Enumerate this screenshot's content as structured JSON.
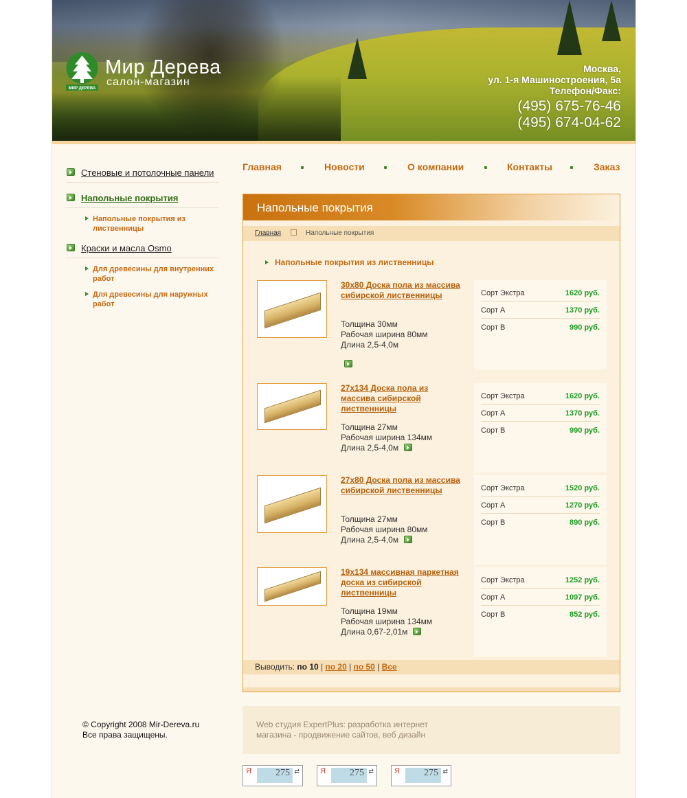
{
  "brand": {
    "title": "Мир Дерева",
    "subtitle": "салон-магазин",
    "mark_text": "МИР ДЕРЕВА"
  },
  "contacts": {
    "city": "Москва,",
    "address": "ул. 1-я Машиностроения, 5а",
    "phone_label": "Телефон/Факс:",
    "phone1": "(495) 675-76-46",
    "phone2": "(495) 674-04-62"
  },
  "topnav": [
    "Главная",
    "Новости",
    "О компании",
    "Контакты",
    "Заказ"
  ],
  "leftnav": {
    "cat1": "Стеновые и потолочные панели",
    "cat2": "Напольные покрытия",
    "cat2_sub1": "Напольные покрытия из лиственницы",
    "cat3": "Краски и масла Osmo",
    "cat3_sub1": "Для древесины для внутренних работ",
    "cat3_sub2": "Для древесины для наружных работ"
  },
  "content": {
    "heading": "Напольные покрытия",
    "breadcrumb_home": "Главная",
    "breadcrumb_current": "Напольные покрытия",
    "section": "Напольные покрытия из лиственницы"
  },
  "products": [
    {
      "title": "30x80 Доска пола из массива сибирской лиственницы",
      "spec1": "Толщина 30мм",
      "spec2": "Рабочая ширина 80мм",
      "spec3": "Длина 2,5-4,0м",
      "prices": [
        {
          "grade": "Сорт Экстра",
          "value": "1620 руб."
        },
        {
          "grade": "Сорт А",
          "value": "1370 руб."
        },
        {
          "grade": "Сорт В",
          "value": "990 руб."
        }
      ]
    },
    {
      "title": "27x134 Доска пола из массива сибирской лиственницы",
      "spec1": "Толщина 27мм",
      "spec2": "Рабочая ширина 134мм",
      "spec3": "Длина 2,5-4,0м",
      "prices": [
        {
          "grade": "Сорт Экстра",
          "value": "1620 руб."
        },
        {
          "grade": "Сорт А",
          "value": "1370 руб."
        },
        {
          "grade": "Сорт В",
          "value": "990 руб."
        }
      ]
    },
    {
      "title": "27x80 Доска пола из массива сибирской лиственницы",
      "spec1": "Толщина 27мм",
      "spec2": "Рабочая ширина 80мм",
      "spec3": "Длина 2,5-4,0м",
      "prices": [
        {
          "grade": "Сорт Экстра",
          "value": "1520 руб."
        },
        {
          "grade": "Сорт А",
          "value": "1270 руб."
        },
        {
          "grade": "Сорт В",
          "value": "890 руб."
        }
      ]
    },
    {
      "title": "19x134 массивная паркетная доска из сибирской лиственницы",
      "spec1": "Толщина 19мм",
      "spec2": "Рабочая ширина 134мм",
      "spec3": "Длина 0,67-2,01м",
      "prices": [
        {
          "grade": "Сорт Экстра",
          "value": "1252 руб."
        },
        {
          "grade": "Сорт А",
          "value": "1097 руб."
        },
        {
          "grade": "Сорт В",
          "value": "852 руб."
        }
      ]
    }
  ],
  "pager": {
    "label": "Выводить:",
    "current": "по 10",
    "sep": "|",
    "opt20": "по 20",
    "opt50": "по 50",
    "all": "Все"
  },
  "footer": {
    "copyright1": "© Copyright 2008 Mir-Dereva.ru",
    "copyright2": "Все права защищены.",
    "studio1": "Web студия ExpertPlus: разработка интернет",
    "studio2": "магазина - продвижение сайтов, веб дизайн"
  },
  "counters": [
    {
      "logo": "Я",
      "value": "275"
    },
    {
      "logo": "Я",
      "value": "275"
    },
    {
      "logo": "Я",
      "value": "275"
    }
  ],
  "colors": {
    "accent": "#c56a12",
    "green": "#1e9b24",
    "border": "#e39d3a"
  }
}
